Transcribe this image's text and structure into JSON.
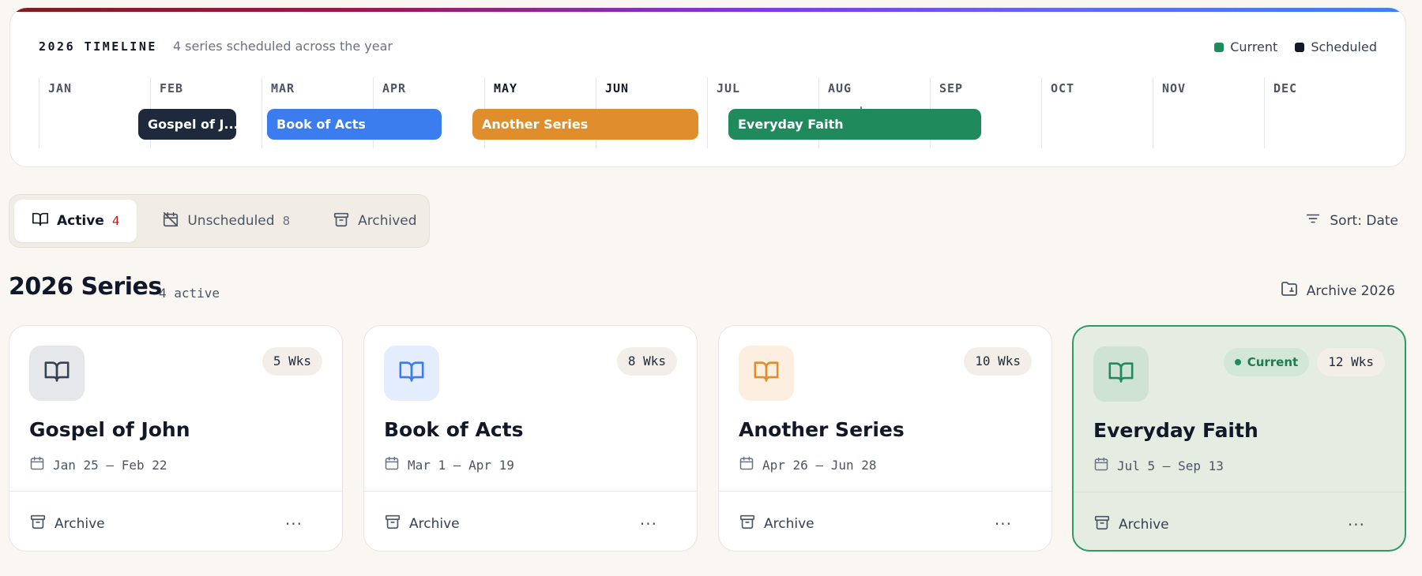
{
  "timeline": {
    "title": "2026 TIMELINE",
    "subtitle": "4 series scheduled across the year",
    "legend": [
      {
        "label": "Current",
        "color": "#1f8a5c"
      },
      {
        "label": "Scheduled",
        "color": "#111827"
      }
    ],
    "months": [
      "JAN",
      "FEB",
      "MAR",
      "APR",
      "MAY",
      "JUN",
      "JUL",
      "AUG",
      "SEP",
      "OCT",
      "NOV",
      "DEC"
    ],
    "bars": [
      {
        "label": "Gospel of J...",
        "color": "#1e293b"
      },
      {
        "label": "Book of Acts",
        "color": "#3b7dee"
      },
      {
        "label": "Another Series",
        "color": "#e08e2b"
      },
      {
        "label": "Everyday Faith",
        "color": "#1f8a5c"
      }
    ]
  },
  "tabs": [
    {
      "label": "Active",
      "count": "4",
      "icon": "book-open-icon"
    },
    {
      "label": "Unscheduled",
      "count": "8",
      "icon": "calendar-off-icon"
    },
    {
      "label": "Archived",
      "count": "",
      "icon": "archive-icon"
    }
  ],
  "sort": {
    "label": "Sort: Date",
    "icon": "filter-lines-icon"
  },
  "section": {
    "title": "2026 Series",
    "count": "4 active",
    "archive_label": "Archive 2026"
  },
  "cards": [
    {
      "title": "Gospel of John",
      "dates": "Jan 25 – Feb 22",
      "weeks": "5 Wks",
      "icon_color": "#374151",
      "icon_bg": "#e5e7eb",
      "current": false
    },
    {
      "title": "Book of Acts",
      "dates": "Mar 1 – Apr 19",
      "weeks": "8 Wks",
      "icon_color": "#3b7dee",
      "icon_bg": "#e3edfd",
      "current": false
    },
    {
      "title": "Another Series",
      "dates": "Apr 26 – Jun 28",
      "weeks": "10 Wks",
      "icon_color": "#e08e2b",
      "icon_bg": "#fcefdf",
      "current": false
    },
    {
      "title": "Everyday Faith",
      "dates": "Jul 5 – Sep 13",
      "weeks": "12 Wks",
      "icon_color": "#1f8a5c",
      "icon_bg": "#cfe3d5",
      "current": true,
      "current_label": "Current"
    }
  ],
  "card_actions": {
    "archive_label": "Archive",
    "more_label": "···"
  }
}
